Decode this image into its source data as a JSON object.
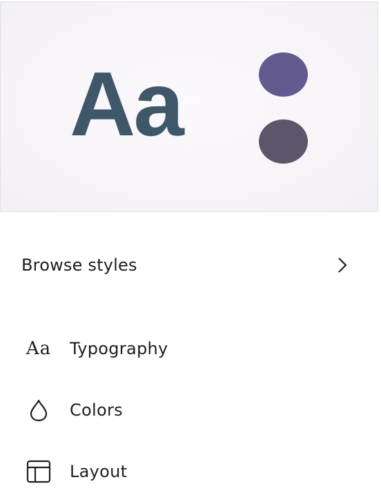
{
  "preview": {
    "sample_text": "Aa",
    "text_color": "#3f5869",
    "swatches": [
      "#635a8f",
      "#5c566b"
    ]
  },
  "browse": {
    "label": "Browse styles",
    "icon": "chevron-right-icon"
  },
  "nav": {
    "items": [
      {
        "label": "Typography",
        "icon": "typography-icon",
        "glyph": "Aa"
      },
      {
        "label": "Colors",
        "icon": "droplet-icon"
      },
      {
        "label": "Layout",
        "icon": "layout-icon"
      }
    ]
  },
  "colors": {
    "text": "#1e1e1e",
    "border": "#e0e0e0"
  }
}
